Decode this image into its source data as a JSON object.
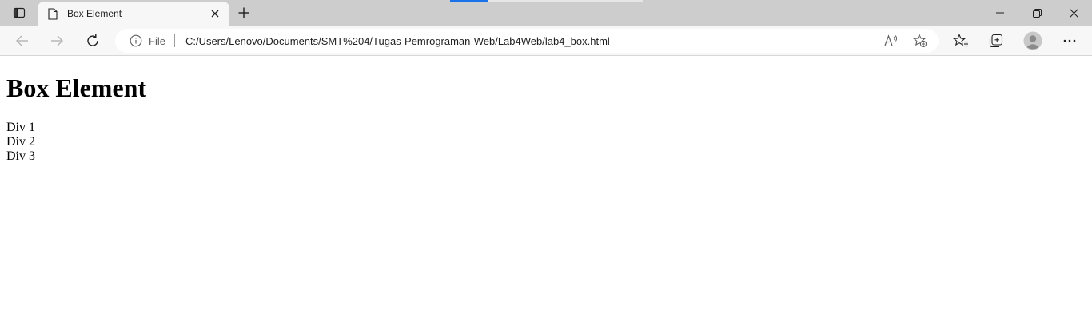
{
  "browser": {
    "tab": {
      "title": "Box Element"
    },
    "address_bar": {
      "scheme_label": "File",
      "url": "C:/Users/Lenovo/Documents/SMT%204/Tugas-Pemrograman-Web/Lab4Web/lab4_box.html"
    },
    "icons": {
      "tab_actions": "tab-actions-icon",
      "tab_page": "document-icon",
      "tab_close": "close-icon",
      "new_tab": "plus-icon",
      "minimize": "minimize-icon",
      "restore": "restore-icon",
      "close_window": "close-icon",
      "back": "arrow-left-icon",
      "forward": "arrow-right-icon",
      "reload": "refresh-icon",
      "site_info": "info-icon",
      "read_aloud": "read-aloud-icon",
      "add_favorite": "star-plus-icon",
      "favorites": "favorites-icon",
      "collections": "collections-icon",
      "profile": "avatar-icon",
      "more": "more-icon"
    },
    "colors": {
      "tabstrip_bg": "#cdcdcd",
      "toolbar_bg": "#f7f7f7",
      "accent": "#1a73e8"
    }
  },
  "page": {
    "heading": "Box Element",
    "divs": [
      "Div 1",
      "Div 2",
      "Div 3"
    ]
  }
}
